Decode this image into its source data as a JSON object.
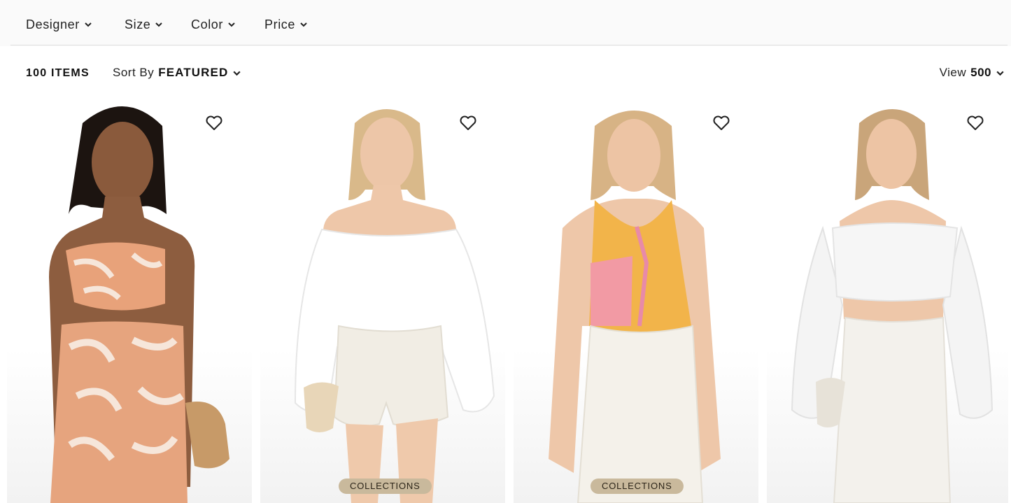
{
  "filters": [
    {
      "label": "Designer",
      "icon": "chevron-down-icon"
    },
    {
      "label": "Size",
      "icon": "chevron-down-icon"
    },
    {
      "label": "Color",
      "icon": "chevron-down-icon"
    },
    {
      "label": "Price",
      "icon": "chevron-down-icon"
    }
  ],
  "toolbar": {
    "items_count": "100 ITEMS",
    "sort_label": "Sort By",
    "sort_value": "FEATURED",
    "view_label": "View",
    "view_value": "500"
  },
  "products": [
    {
      "image": "model in orange floral bandeau top and matching pants",
      "wishlist_icon": "heart-outline-icon",
      "badge": ""
    },
    {
      "image": "model in white off-shoulder blouse and white shorts",
      "wishlist_icon": "heart-outline-icon",
      "badge": "COLLECTIONS"
    },
    {
      "image": "model in pink and yellow patchwork halter scarf top",
      "wishlist_icon": "heart-outline-icon",
      "badge": "COLLECTIONS"
    },
    {
      "image": "model in sheer polka dot off-shoulder crop top and white pants",
      "wishlist_icon": "heart-outline-icon",
      "badge": ""
    }
  ],
  "colors": {
    "badge_bg": "#c9b99c",
    "divider": "#dedede",
    "text": "#1a1a1a"
  }
}
